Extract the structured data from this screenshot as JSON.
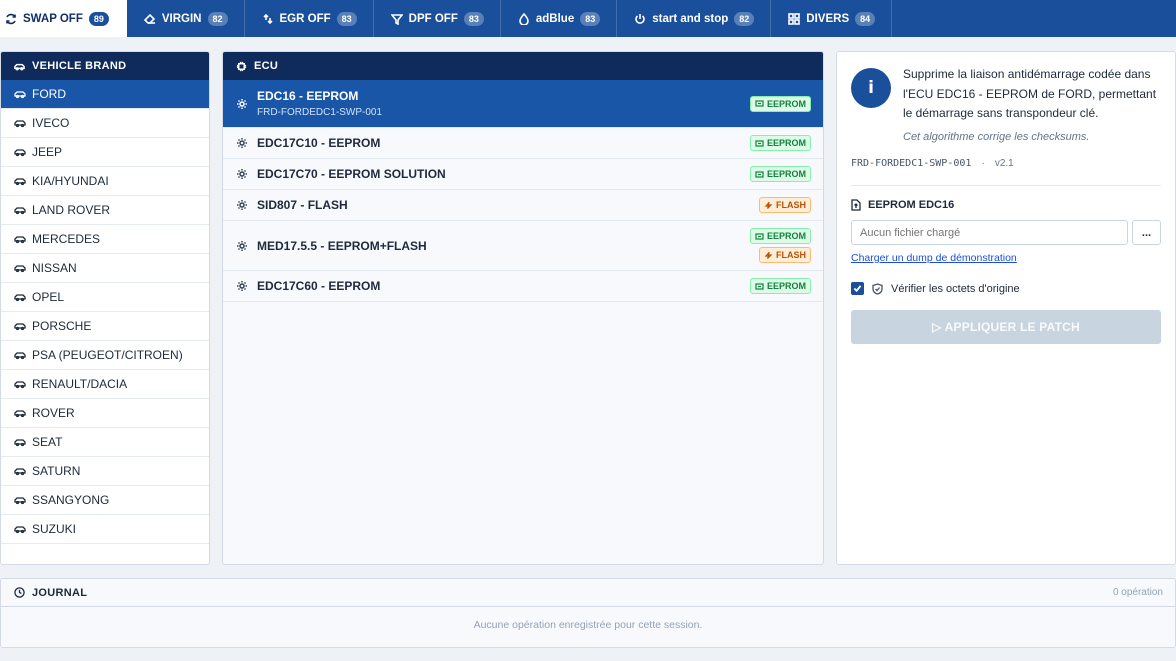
{
  "tabs": [
    {
      "label": "SWAP OFF",
      "count": "89",
      "icon": "refresh-icon",
      "active": true
    },
    {
      "label": "VIRGIN",
      "count": "82",
      "icon": "eraser-icon"
    },
    {
      "label": "EGR OFF",
      "count": "83",
      "icon": "recycle-icon"
    },
    {
      "label": "DPF OFF",
      "count": "83",
      "icon": "filter-icon"
    },
    {
      "label": "adBlue",
      "count": "83",
      "icon": "droplet-icon"
    },
    {
      "label": "start and stop",
      "count": "82",
      "icon": "power-icon"
    },
    {
      "label": "DIVERS",
      "count": "84",
      "icon": "grid-icon"
    }
  ],
  "brands": {
    "header": "VEHICLE BRAND",
    "items": [
      "FORD",
      "IVECO",
      "JEEP",
      "KIA/HYUNDAI",
      "LAND ROVER",
      "MERCEDES",
      "NISSAN",
      "OPEL",
      "PORSCHE",
      "PSA (PEUGEOT/CITROEN)",
      "RENAULT/DACIA",
      "ROVER",
      "SEAT",
      "SATURN",
      "SSANGYONG",
      "SUZUKI"
    ],
    "selected": "FORD"
  },
  "ecu": {
    "header": "ECU",
    "items": [
      {
        "name": "EDC16 - EEPROM",
        "code": "FRD-FORDEDC1-SWP-001",
        "tags": [
          "EEPROM"
        ],
        "selected": true
      },
      {
        "name": "EDC17C10 - EEPROM",
        "tags": [
          "EEPROM"
        ]
      },
      {
        "name": "EDC17C70 - EEPROM SOLUTION",
        "tags": [
          "EEPROM"
        ]
      },
      {
        "name": "SID807 - FLASH",
        "tags": [
          "FLASH"
        ]
      },
      {
        "name": "MED17.5.5 - EEPROM+FLASH",
        "tags": [
          "EEPROM",
          "FLASH"
        ]
      },
      {
        "name": "EDC17C60 - EEPROM",
        "tags": [
          "EEPROM"
        ]
      }
    ]
  },
  "detail": {
    "info_glyph": "i",
    "description": "Supprime la liaison antidémarrage codée dans l'ECU EDC16 - EEPROM de FORD, permettant le démarrage sans transpondeur clé.",
    "checksum_note": "Cet algorithme corrige les checksums.",
    "algo_code": "FRD-FORDEDC1-SWP-001",
    "version": "v2.1",
    "eeprom_title": "EEPROM EDC16",
    "file_placeholder": "Aucun fichier chargé",
    "browse_label": "...",
    "demo_link": "Charger un dump de démonstration",
    "verify_label": "Vérifier les octets d'origine",
    "verify_checked": true,
    "apply_label": "▷ APPLIQUER LE PATCH"
  },
  "journal": {
    "header": "JOURNAL",
    "count": "0 opération",
    "empty": "Aucune opération enregistrée pour cette session."
  },
  "colors": {
    "primary": "#1a4f9c",
    "selected": "#1a56a8",
    "header": "#0f2b5b",
    "eeprom_tag": "#15803d",
    "flash_tag": "#b45309"
  }
}
